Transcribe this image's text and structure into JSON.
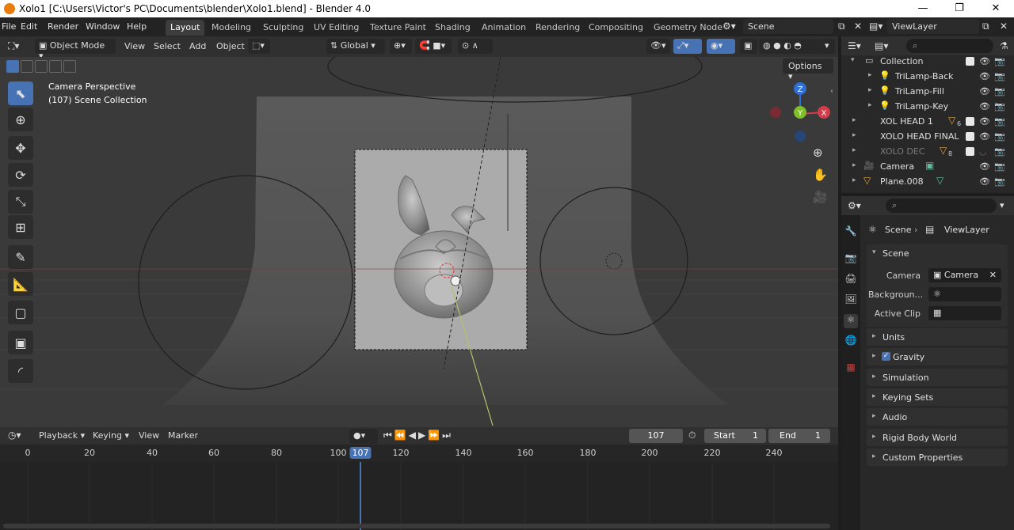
{
  "window": {
    "title": "Xolo1 [C:\\Users\\Victor's PC\\Documents\\blender\\Xolo1.blend] - Blender 4.0",
    "minimize": "—",
    "maximize": "❐",
    "close": "✕"
  },
  "menu": {
    "file": "File",
    "edit": "Edit",
    "render": "Render",
    "window": "Window",
    "help": "Help"
  },
  "workspaces": [
    "Layout",
    "Modeling",
    "Sculpting",
    "UV Editing",
    "Texture Paint",
    "Shading",
    "Animation",
    "Rendering",
    "Compositing",
    "Geometry Node"
  ],
  "scene_field": "Scene",
  "viewlayer_field": "ViewLayer",
  "viewport_header": {
    "mode": "Object Mode",
    "view": "View",
    "select": "Select",
    "add": "Add",
    "object": "Object",
    "transform": "Global",
    "options": "Options"
  },
  "viewport": {
    "info_line1": "Camera Perspective",
    "info_line2": "(107) Scene Collection",
    "gizmo_z": "Z",
    "gizmo_y": "Y",
    "gizmo_x": "X"
  },
  "timeline": {
    "playback": "Playback",
    "keying": "Keying",
    "view": "View",
    "marker": "Marker",
    "current_frame": "107",
    "start_label": "Start",
    "start_value": "1",
    "end_label": "End",
    "end_value": "1",
    "ticks": [
      "0",
      "20",
      "40",
      "60",
      "80",
      "100",
      "120",
      "140",
      "160",
      "180",
      "200",
      "220",
      "240"
    ],
    "frame_badge": "107"
  },
  "outliner": {
    "items": [
      {
        "name": "Collection"
      },
      {
        "name": "TriLamp-Back"
      },
      {
        "name": "TriLamp-Fill"
      },
      {
        "name": "TriLamp-Key"
      },
      {
        "name": "XOL HEAD 1",
        "badge": "6"
      },
      {
        "name": "XOLO HEAD FINAL"
      },
      {
        "name": "XOLO DEC",
        "badge": "8"
      },
      {
        "name": "Camera"
      },
      {
        "name": "Plane.008"
      }
    ]
  },
  "properties": {
    "breadcrumb_scene": "Scene",
    "breadcrumb_viewlayer": "ViewLayer",
    "scene_panel": "Scene",
    "camera_label": "Camera",
    "camera_value": "Camera",
    "background_label": "Backgroun...",
    "active_clip_label": "Active Clip",
    "panels": [
      "Units",
      "Gravity",
      "Simulation",
      "Keying Sets",
      "Audio",
      "Rigid Body World",
      "Custom Properties"
    ]
  }
}
